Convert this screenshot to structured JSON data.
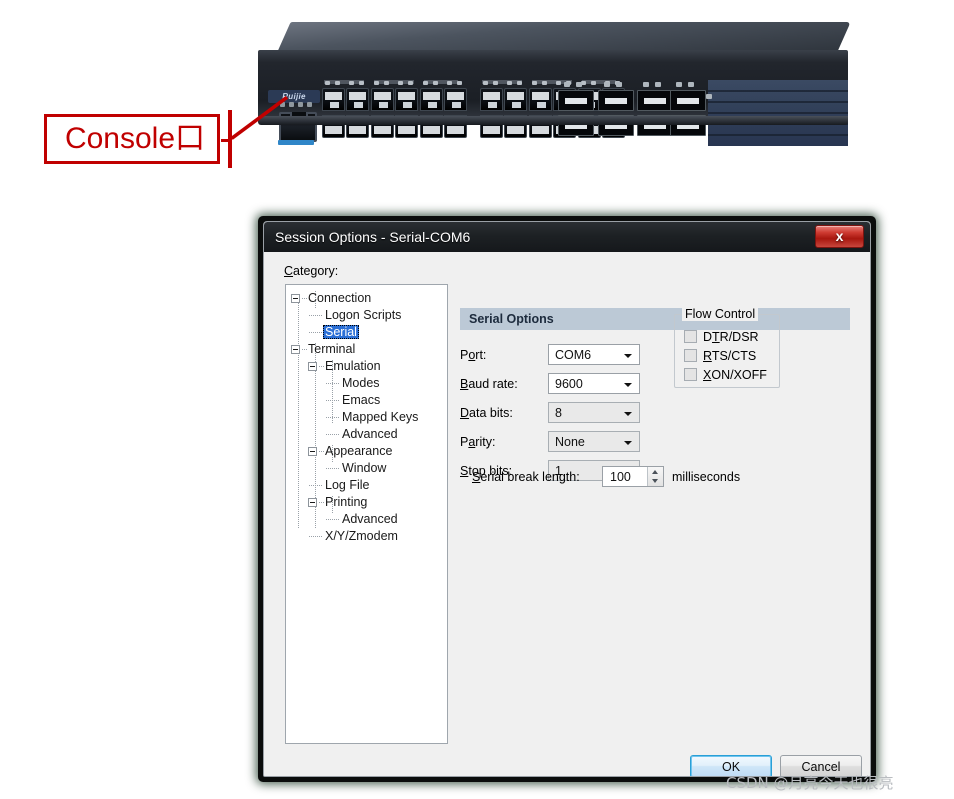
{
  "callout": {
    "label": "Console口",
    "color": "#c00000"
  },
  "device": {
    "brand": "Ruijie"
  },
  "dialog": {
    "title": "Session Options - Serial-COM6",
    "close_label": "x",
    "category_label": "Category:",
    "category_mnemonic": "C",
    "tree": [
      {
        "label": "Connection",
        "depth": 0,
        "expander": "minus",
        "selected": false
      },
      {
        "label": "Logon Scripts",
        "depth": 1,
        "expander": "none",
        "selected": false
      },
      {
        "label": "Serial",
        "depth": 1,
        "expander": "none",
        "selected": true
      },
      {
        "label": "Terminal",
        "depth": 0,
        "expander": "minus",
        "selected": false
      },
      {
        "label": "Emulation",
        "depth": 1,
        "expander": "minus",
        "selected": false
      },
      {
        "label": "Modes",
        "depth": 2,
        "expander": "none",
        "selected": false
      },
      {
        "label": "Emacs",
        "depth": 2,
        "expander": "none",
        "selected": false
      },
      {
        "label": "Mapped Keys",
        "depth": 2,
        "expander": "none",
        "selected": false
      },
      {
        "label": "Advanced",
        "depth": 2,
        "expander": "none",
        "selected": false
      },
      {
        "label": "Appearance",
        "depth": 1,
        "expander": "minus",
        "selected": false
      },
      {
        "label": "Window",
        "depth": 2,
        "expander": "none",
        "selected": false
      },
      {
        "label": "Log File",
        "depth": 1,
        "expander": "none",
        "selected": false
      },
      {
        "label": "Printing",
        "depth": 1,
        "expander": "minus",
        "selected": false
      },
      {
        "label": "Advanced",
        "depth": 2,
        "expander": "none",
        "selected": false
      },
      {
        "label": "X/Y/Zmodem",
        "depth": 1,
        "expander": "none",
        "selected": false
      }
    ],
    "section_title": "Serial Options",
    "fields": [
      {
        "name": "port",
        "label_pre": "P",
        "label_mn": "o",
        "label_post": "rt:",
        "value": "COM6",
        "style": "white"
      },
      {
        "name": "baud_rate",
        "label_pre": "",
        "label_mn": "B",
        "label_post": "aud rate:",
        "value": "9600",
        "style": "white"
      },
      {
        "name": "data_bits",
        "label_pre": "",
        "label_mn": "D",
        "label_post": "ata bits:",
        "value": "8",
        "style": "grey"
      },
      {
        "name": "parity",
        "label_pre": "P",
        "label_mn": "a",
        "label_post": "rity:",
        "value": "None",
        "style": "grey"
      },
      {
        "name": "stop_bits",
        "label_pre": "",
        "label_mn": "S",
        "label_post": "top bits:",
        "value": "1",
        "style": "grey"
      }
    ],
    "flow_control": {
      "title": "Flow Control",
      "items": [
        {
          "pre": "D",
          "mn": "T",
          "post": "R/DSR",
          "checked": false
        },
        {
          "pre": "",
          "mn": "R",
          "post": "TS/CTS",
          "checked": false
        },
        {
          "pre": "",
          "mn": "X",
          "post": "ON/XOFF",
          "checked": false
        }
      ]
    },
    "serial_break": {
      "label_pre": "",
      "label_mn": "S",
      "label_post": "erial break length:",
      "value": "100",
      "units": "milliseconds"
    },
    "buttons": {
      "ok": "OK",
      "cancel": "Cancel"
    }
  },
  "watermark": "CSDN @月亮今天也很亮"
}
